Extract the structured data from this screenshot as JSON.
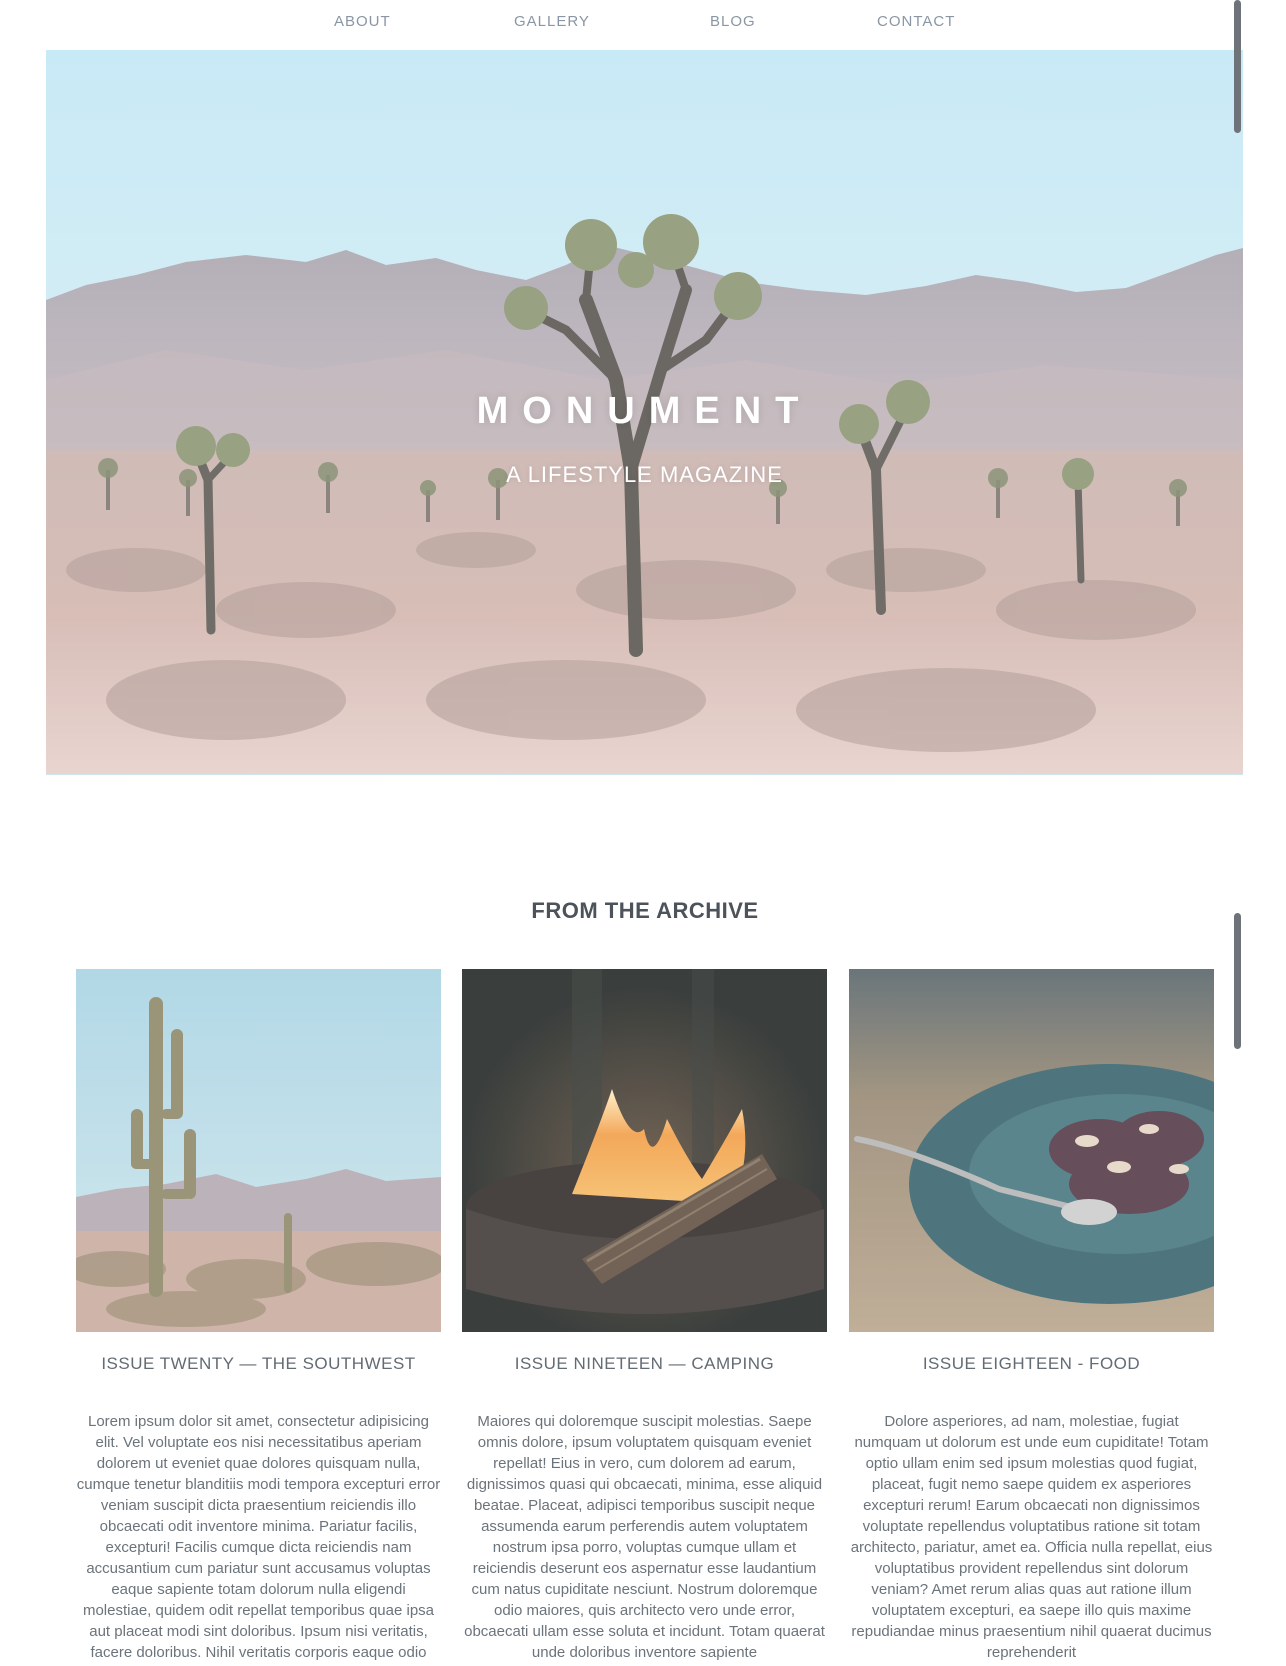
{
  "nav": {
    "items": [
      {
        "label": "ABOUT"
      },
      {
        "label": "GALLERY"
      },
      {
        "label": "BLOG"
      },
      {
        "label": "CONTACT"
      }
    ]
  },
  "hero": {
    "title": "MONUMENT",
    "subtitle": "A LIFESTYLE MAGAZINE"
  },
  "archive": {
    "heading": "FROM THE ARCHIVE",
    "cards": [
      {
        "title": "ISSUE TWENTY — THE SOUTHWEST",
        "text": "Lorem ipsum dolor sit amet, consectetur adipisicing elit. Vel voluptate eos nisi necessitatibus aperiam dolorem ut eveniet quae dolores quisquam nulla, cumque tenetur blanditiis modi tempora excepturi error veniam suscipit dicta praesentium reiciendis illo obcaecati odit inventore minima. Pariatur facilis, excepturi! Facilis cumque dicta reiciendis nam accusantium cum pariatur sunt accusamus voluptas eaque sapiente totam dolorum nulla eligendi molestiae, quidem odit repellat temporibus quae ipsa aut placeat modi sint doloribus. Ipsum nisi veritatis, facere doloribus. Nihil veritatis corporis eaque odio"
      },
      {
        "title": "ISSUE NINETEEN — CAMPING",
        "text": "Maiores qui doloremque suscipit molestias. Saepe omnis dolore, ipsum voluptatem quisquam eveniet repellat! Eius in vero, cum dolorem ad earum, dignissimos quasi qui obcaecati, minima, esse aliquid beatae. Placeat, adipisci temporibus suscipit neque assumenda earum perferendis autem voluptatem nostrum ipsa porro, voluptas cumque ullam et reiciendis deserunt eos aspernatur esse laudantium cum natus cupiditate nesciunt. Nostrum doloremque odio maiores, quis architecto vero unde error, obcaecati ullam esse soluta et incidunt. Totam quaerat unde doloribus inventore sapiente"
      },
      {
        "title": "ISSUE EIGHTEEN - FOOD",
        "text": "Dolore asperiores, ad nam, molestiae, fugiat numquam ut dolorum est unde eum cupiditate! Totam optio ullam enim sed ipsum molestias quod fugiat, placeat, fugit nemo saepe quidem ex asperiores excepturi rerum! Earum obcaecati non dignissimos voluptate repellendus voluptatibus ratione sit totam architecto, pariatur, amet ea. Officia nulla repellat, eius voluptatibus provident repellendus sint dolorum veniam? Amet rerum alias quas aut ratione illum voluptatem excepturi, ea saepe illo quis maxime repudiandae minus praesentium nihil quaerat ducimus reprehenderit"
      }
    ]
  },
  "colors": {
    "nav_text": "#8a96a3",
    "heading_text": "#4c535a",
    "body_text": "#6b737b",
    "sky": "#c3e9f3"
  }
}
